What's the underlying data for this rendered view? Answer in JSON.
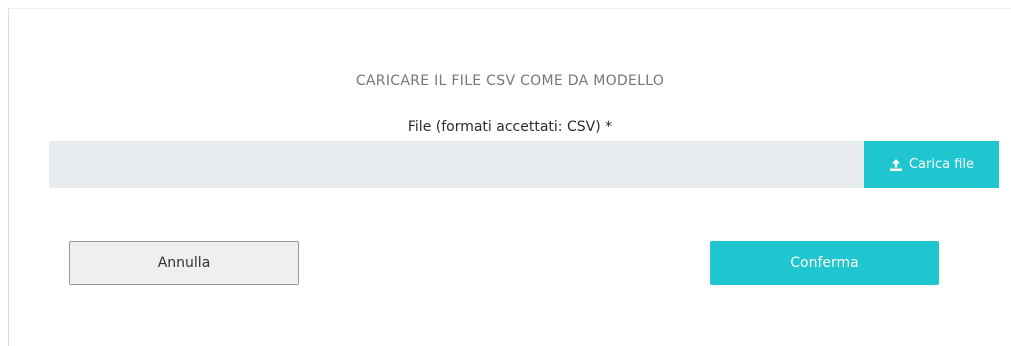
{
  "dialog": {
    "heading": "CARICARE IL FILE CSV COME DA MODELLO",
    "file_label": "File (formati accettati: CSV) *",
    "file_field": {
      "value": "",
      "placeholder": ""
    },
    "upload_button_label": "Carica file",
    "upload_icon": "upload-icon",
    "cancel_label": "Annulla",
    "confirm_label": "Conferma"
  },
  "colors": {
    "accent": "#1fc5cf",
    "field_background": "#e9ecef",
    "cancel_background": "#efefef",
    "heading_text": "#777777"
  }
}
